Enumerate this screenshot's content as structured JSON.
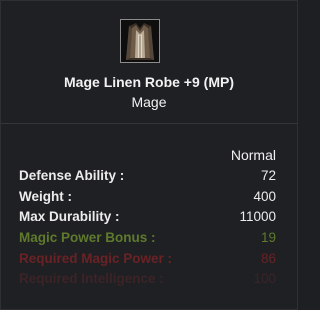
{
  "item": {
    "name": "Mage Linen Robe +9 (MP)",
    "class": "Mage",
    "icon": "linen-robe-icon",
    "grade": "Normal"
  },
  "stats": [
    {
      "label": "Defense Ability :",
      "value": "72",
      "color": "#ececec"
    },
    {
      "label": "Weight :",
      "value": "400",
      "color": "#ececec"
    },
    {
      "label": "Max Durability :",
      "value": "11000",
      "color": "#ececec"
    },
    {
      "label": "Magic Power Bonus :",
      "value": "19",
      "color": "#5f7a2c"
    },
    {
      "label": "Required Magic Power :",
      "value": "86",
      "color": "#6a2225"
    },
    {
      "label": "Required Intelligence :",
      "value": "100",
      "color": "#3c2326"
    }
  ]
}
